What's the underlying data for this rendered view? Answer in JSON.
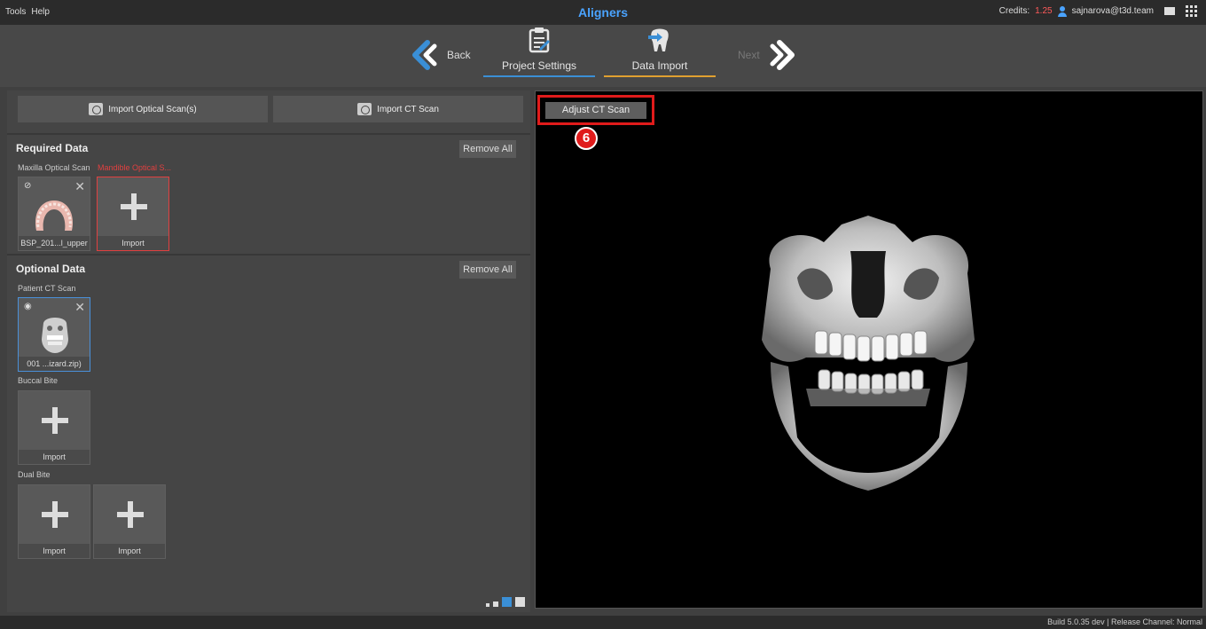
{
  "topbar": {
    "menu": [
      "Tools",
      "Help"
    ],
    "title": "Aligners",
    "credits_label": "Credits:",
    "credits_value": "1.25",
    "user_email": "sajnarova@t3d.team"
  },
  "wizard": {
    "back_label": "Back",
    "next_label": "Next",
    "steps": [
      {
        "label": "Project Settings"
      },
      {
        "label": "Data Import"
      }
    ],
    "colors": {
      "project_underline": "#3a8fd6",
      "data_underline": "#e0a030",
      "back_arrow": "#3a8fd6"
    }
  },
  "left": {
    "import_optical_label": "Import Optical Scan(s)",
    "import_ct_label": "Import CT Scan",
    "required": {
      "title": "Required Data",
      "remove_all": "Remove All",
      "maxilla_label": "Maxilla Optical Scan",
      "mandible_label": "Mandible Optical S...",
      "maxilla_file": "BSP_201...l_upper",
      "import_label": "Import"
    },
    "optional": {
      "title": "Optional Data",
      "remove_all": "Remove All",
      "ct_label": "Patient CT Scan",
      "ct_file": "001     ...izard.zip)",
      "buccal_label": "Buccal Bite",
      "buccal_import": "Import",
      "dual_label": "Dual Bite",
      "dual_import_1": "Import",
      "dual_import_2": "Import"
    }
  },
  "viewport": {
    "adjust_label": "Adjust CT Scan",
    "annotation_number": "6",
    "annotation_color": "#e01b1b"
  },
  "statusbar": {
    "text": "Build 5.0.35  dev  | Release Channel: Normal"
  }
}
